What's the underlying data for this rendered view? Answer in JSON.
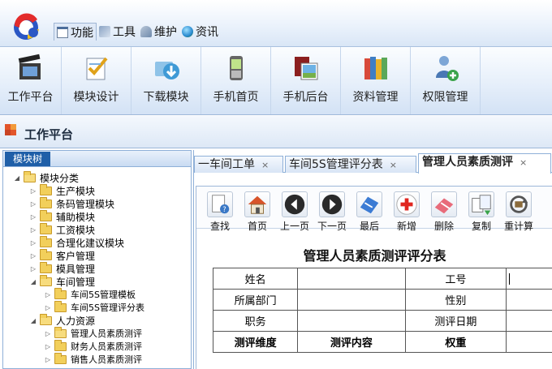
{
  "menu": {
    "items": [
      {
        "label": "功能",
        "icon": "window-icon",
        "active": true
      },
      {
        "label": "工具",
        "icon": "tools-icon",
        "active": false
      },
      {
        "label": "维护",
        "icon": "maintenance-icon",
        "active": false
      },
      {
        "label": "资讯",
        "icon": "globe-icon",
        "active": false
      }
    ]
  },
  "ribbon": {
    "items": [
      {
        "label": "工作平台",
        "icon": "clapperboard-icon"
      },
      {
        "label": "模块设计",
        "icon": "design-checklist-icon"
      },
      {
        "label": "下载模块",
        "icon": "download-icon"
      },
      {
        "label": "手机首页",
        "icon": "mobile-phone-icon"
      },
      {
        "label": "手机后台",
        "icon": "mobile-admin-icon"
      },
      {
        "label": "资料管理",
        "icon": "books-icon"
      },
      {
        "label": "权限管理",
        "icon": "user-permission-icon"
      }
    ]
  },
  "workspace": {
    "title": "工作平台"
  },
  "left_panel": {
    "tab": "模块树",
    "tree": [
      {
        "label": "模块分类",
        "level": 0,
        "expanded": true
      },
      {
        "label": "生产模块",
        "level": 1,
        "expanded": false
      },
      {
        "label": "条码管理模块",
        "level": 1,
        "expanded": false
      },
      {
        "label": "辅助模块",
        "level": 1,
        "expanded": false
      },
      {
        "label": "工资模块",
        "level": 1,
        "expanded": false
      },
      {
        "label": "合理化建议模块",
        "level": 1,
        "expanded": false
      },
      {
        "label": "客户管理",
        "level": 1,
        "expanded": false
      },
      {
        "label": "模具管理",
        "level": 1,
        "expanded": false
      },
      {
        "label": "车间管理",
        "level": 1,
        "expanded": true
      },
      {
        "label": "车间5S管理模板",
        "level": 2,
        "expanded": false
      },
      {
        "label": "车间5S管理评分表",
        "level": 2,
        "expanded": false
      },
      {
        "label": "人力资源",
        "level": 1,
        "expanded": true
      },
      {
        "label": "管理人员素质测评",
        "level": 2,
        "expanded": false
      },
      {
        "label": "财务人员素质测评",
        "level": 2,
        "expanded": false
      },
      {
        "label": "销售人员素质测评",
        "level": 2,
        "expanded": false
      }
    ]
  },
  "tabs": [
    {
      "label": "一车间工单",
      "close": "×"
    },
    {
      "label": "车间5S管理评分表",
      "close": "×"
    },
    {
      "label": "管理人员素质测评",
      "close": "×",
      "active": true
    }
  ],
  "doc_toolbar": {
    "items": [
      {
        "label": "查找",
        "icon": "search-doc-icon"
      },
      {
        "label": "首页",
        "icon": "home-icon"
      },
      {
        "label": "上一页",
        "icon": "previous-icon"
      },
      {
        "label": "下一页",
        "icon": "next-icon"
      },
      {
        "label": "最后",
        "icon": "last-icon"
      },
      {
        "label": "新增",
        "icon": "add-icon"
      },
      {
        "label": "删除",
        "icon": "delete-icon"
      },
      {
        "label": "复制",
        "icon": "copy-icon"
      },
      {
        "label": "重计算",
        "icon": "recalculate-icon"
      }
    ]
  },
  "form": {
    "title": "管理人员素质测评评分表",
    "rows": [
      [
        "姓名",
        "",
        "工号",
        ""
      ],
      [
        "所属部门",
        "",
        "性别",
        ""
      ],
      [
        "职务",
        "",
        "测评日期",
        ""
      ],
      [
        "测评维度",
        "测评内容",
        "权重",
        ""
      ]
    ]
  }
}
